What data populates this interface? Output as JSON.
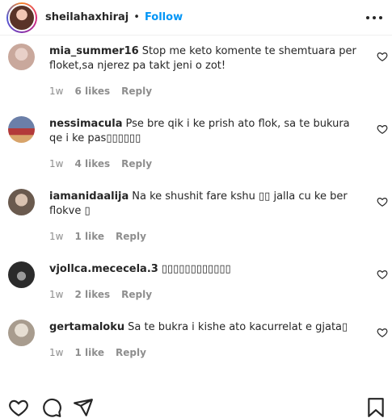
{
  "header": {
    "username": "sheilahaxhiraj",
    "separator": "•",
    "follow_label": "Follow"
  },
  "comments": [
    {
      "username": "mia_summer16",
      "text": "Stop me keto komente te shemtuara per floket,sa njerez pa takt jeni o zot!",
      "time": "1w",
      "likes": "6 likes",
      "reply": "Reply",
      "avatar_colors": [
        "#c9a89c",
        "#e8d0c8"
      ]
    },
    {
      "username": "nessimacula",
      "text": "Pse bre qik i ke prish ato flok, sa te bukura qe i ke pas▯▯▯▯▯▯",
      "time": "1w",
      "likes": "4 likes",
      "reply": "Reply",
      "avatar_colors": [
        "#6b7fa8",
        "#b33a3a"
      ]
    },
    {
      "username": "iamanidaalija",
      "text": "Na ke shushit fare kshu ▯▯ jalla cu ke ber flokve ▯",
      "time": "1w",
      "likes": "1 like",
      "reply": "Reply",
      "avatar_colors": [
        "#8a7a6e",
        "#d9c2b0"
      ]
    },
    {
      "username": "vjollca.mececela.3",
      "text": "▯▯▯▯▯▯▯▯▯▯▯▯",
      "time": "1w",
      "likes": "2 likes",
      "reply": "Reply",
      "avatar_colors": [
        "#2b2b2b",
        "#9a9a9a"
      ]
    },
    {
      "username": "gertamaloku",
      "text": "Sa te bukra i kishe ato kacurrelat e gjata▯",
      "time": "1w",
      "likes": "1 like",
      "reply": "Reply",
      "avatar_colors": [
        "#b8b0a4",
        "#e6ded2"
      ]
    }
  ],
  "icons": {
    "like": "heart-icon",
    "comment": "comment-icon",
    "share": "share-icon",
    "save": "bookmark-icon"
  }
}
